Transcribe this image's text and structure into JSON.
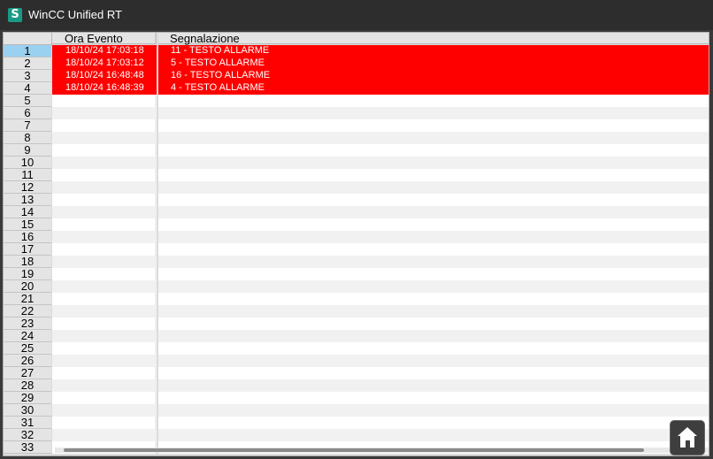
{
  "window": {
    "app_icon_letter": "S",
    "title": "WinCC Unified RT"
  },
  "table": {
    "headers": {
      "time": "Ora Evento",
      "message": "Segnalazione"
    },
    "selected_row": "1",
    "rows": [
      {
        "num": "1",
        "time": "18/10/24 17:03:18",
        "message": "11 - TESTO ALLARME",
        "alarm": true
      },
      {
        "num": "2",
        "time": "18/10/24 17:03:12",
        "message": "5 - TESTO ALLARME",
        "alarm": true
      },
      {
        "num": "3",
        "time": "18/10/24 16:48:48",
        "message": "16 - TESTO ALLARME",
        "alarm": true
      },
      {
        "num": "4",
        "time": "18/10/24 16:48:39",
        "message": "4 - TESTO ALLARME",
        "alarm": true
      },
      {
        "num": "5",
        "time": "",
        "message": "",
        "alarm": false
      },
      {
        "num": "6",
        "time": "",
        "message": "",
        "alarm": false
      },
      {
        "num": "7",
        "time": "",
        "message": "",
        "alarm": false
      },
      {
        "num": "8",
        "time": "",
        "message": "",
        "alarm": false
      },
      {
        "num": "9",
        "time": "",
        "message": "",
        "alarm": false
      },
      {
        "num": "10",
        "time": "",
        "message": "",
        "alarm": false
      },
      {
        "num": "11",
        "time": "",
        "message": "",
        "alarm": false
      },
      {
        "num": "12",
        "time": "",
        "message": "",
        "alarm": false
      },
      {
        "num": "13",
        "time": "",
        "message": "",
        "alarm": false
      },
      {
        "num": "14",
        "time": "",
        "message": "",
        "alarm": false
      },
      {
        "num": "15",
        "time": "",
        "message": "",
        "alarm": false
      },
      {
        "num": "16",
        "time": "",
        "message": "",
        "alarm": false
      },
      {
        "num": "17",
        "time": "",
        "message": "",
        "alarm": false
      },
      {
        "num": "18",
        "time": "",
        "message": "",
        "alarm": false
      },
      {
        "num": "19",
        "time": "",
        "message": "",
        "alarm": false
      },
      {
        "num": "20",
        "time": "",
        "message": "",
        "alarm": false
      },
      {
        "num": "21",
        "time": "",
        "message": "",
        "alarm": false
      },
      {
        "num": "22",
        "time": "",
        "message": "",
        "alarm": false
      },
      {
        "num": "23",
        "time": "",
        "message": "",
        "alarm": false
      },
      {
        "num": "24",
        "time": "",
        "message": "",
        "alarm": false
      },
      {
        "num": "25",
        "time": "",
        "message": "",
        "alarm": false
      },
      {
        "num": "26",
        "time": "",
        "message": "",
        "alarm": false
      },
      {
        "num": "27",
        "time": "",
        "message": "",
        "alarm": false
      },
      {
        "num": "28",
        "time": "",
        "message": "",
        "alarm": false
      },
      {
        "num": "29",
        "time": "",
        "message": "",
        "alarm": false
      },
      {
        "num": "30",
        "time": "",
        "message": "",
        "alarm": false
      },
      {
        "num": "31",
        "time": "",
        "message": "",
        "alarm": false
      },
      {
        "num": "32",
        "time": "",
        "message": "",
        "alarm": false
      },
      {
        "num": "33",
        "time": "",
        "message": "",
        "alarm": false
      }
    ]
  },
  "colors": {
    "alarm_background": "#ff0000",
    "alarm_text": "#ffffff",
    "selected_row_header": "#9ad0f0",
    "app_icon": "#1a9a86"
  },
  "icons": {
    "app": "siemens-s-icon",
    "home_button": "home-icon"
  }
}
